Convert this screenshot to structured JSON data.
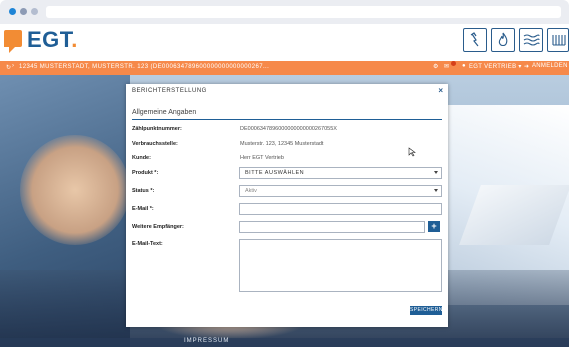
{
  "browser": {
    "url": ""
  },
  "header": {
    "logo_text": "EGT",
    "logo_dot": ".",
    "icons": [
      "plug-icon",
      "flame-icon",
      "waves-icon",
      "radiator-icon"
    ]
  },
  "orange_bar": {
    "address": "12345 MUSTERSTADT, MUSTERSTR. 123 (DE000634789600000000000000267...",
    "user_label": "EGT VERTRIEB",
    "login_label": "ANMELDEN",
    "notification_count": "1"
  },
  "modal": {
    "title": "BERICHTERSTELLUNG",
    "close": "×",
    "section_title": "Allgemeine Angaben",
    "fields": {
      "zaehlpunkt_label": "Zählpunktnummer:",
      "zaehlpunkt_value": "DE0006347896000000000000267055X",
      "verbrauchsstelle_label": "Verbrauchsstelle:",
      "verbrauchsstelle_value": "Musterstr. 123, 12345 Musterstadt",
      "kunde_label": "Kunde:",
      "kunde_value": "Herr EGT Vertrieb",
      "produkt_label": "Produkt *:",
      "produkt_value": "BITTE AUSWÄHLEN",
      "status_label": "Status *:",
      "status_value": "Aktiv",
      "email_label": "E-Mail *:",
      "email_value": "",
      "empfaenger_label": "Weitere Empfänger:",
      "empfaenger_value": "",
      "emailtext_label": "E-Mail-Text:",
      "emailtext_value": ""
    },
    "save_button": "SPEICHERN"
  },
  "footer": {
    "impressum": "IMPRESSUM"
  },
  "colors": {
    "brand_blue": "#1f5e96",
    "brand_orange": "#f28c34",
    "bar_orange": "#f6894a"
  }
}
